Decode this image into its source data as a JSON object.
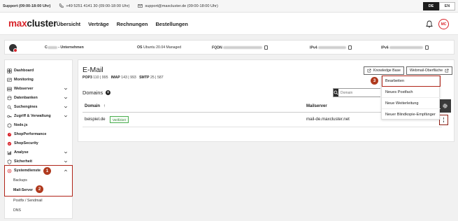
{
  "support": {
    "hours": "Support (09:00-18:00 Uhr)",
    "phone": "+49 5251 4141 30 (09:00-18:00 Uhr)",
    "email": "support@maxcluster.de (09:00-18:00 Uhr)"
  },
  "languages": [
    "DE",
    "EN"
  ],
  "brand": {
    "part1": "max",
    "part2": "cluster",
    "accent": "#d8232a"
  },
  "nav": [
    "Übersicht",
    "Verträge",
    "Rechnungen",
    "Bestellungen"
  ],
  "user_initials": "MC",
  "server_info": {
    "customer_prefix": "C",
    "customer_suffix": " - Unternehmen",
    "os_label": "OS",
    "os_value": "Ubuntu 20.04 Managed",
    "fqdn_label": "FQDN",
    "ipv4_label": "IPv4",
    "ipv6_label": "IPv6"
  },
  "sidebar": {
    "items": [
      {
        "label": "Dashboard",
        "icon": "dashboard-icon"
      },
      {
        "label": "Monitoring",
        "icon": "monitoring-icon"
      },
      {
        "label": "Webserver",
        "icon": "webserver-icon",
        "chevron": "down"
      },
      {
        "label": "Datenbanken",
        "icon": "database-icon",
        "chevron": "down"
      },
      {
        "label": "Suchengines",
        "icon": "search-engine-icon",
        "chevron": "down"
      },
      {
        "label": "Zugriff & Verwaltung",
        "icon": "key-icon",
        "chevron": "down"
      },
      {
        "label": "Node.js",
        "icon": "nodejs-icon"
      },
      {
        "label": "ShopPerformance",
        "icon": "shopperformance-icon"
      },
      {
        "label": "ShopSecurity",
        "icon": "shopsecurity-icon"
      },
      {
        "label": "Analyse",
        "icon": "analyse-icon",
        "chevron": "down"
      },
      {
        "label": "Sicherheit",
        "icon": "shield-icon",
        "chevron": "down"
      },
      {
        "label": "Systemdienste",
        "icon": "system-services-icon",
        "chevron": "up"
      }
    ],
    "subitems": [
      "Backups",
      "Mail-Server",
      "Postfix / Sendmail",
      "DNS"
    ]
  },
  "main": {
    "title": "E-Mail",
    "protocols": [
      {
        "name": "POP3",
        "ports": "110 | 995"
      },
      {
        "name": "IMAP",
        "ports": "143 | 993"
      },
      {
        "name": "SMTP",
        "ports": "25 | 587"
      }
    ],
    "knowledge_base": "Knowledge Base",
    "webmail": "Webmail-Oberfläche",
    "domains_heading": "Domains",
    "search_placeholder": "Domain",
    "table": {
      "headers": [
        "Domain",
        "Mailserver"
      ],
      "sort_indicator": "↑",
      "rows": [
        {
          "domain": "beispiel.de",
          "status": "Verifiziert",
          "mailserver": "mail-de.maxcluster.net"
        }
      ]
    },
    "dropdown": [
      "Bearbeiten",
      "Neues Postfach",
      "Neue Weiterleitung",
      "Neuer Blindkopie-Empfänger"
    ]
  },
  "annotations": {
    "step1": "1",
    "step2": "2",
    "step3": "3",
    "color": "#b02418"
  }
}
